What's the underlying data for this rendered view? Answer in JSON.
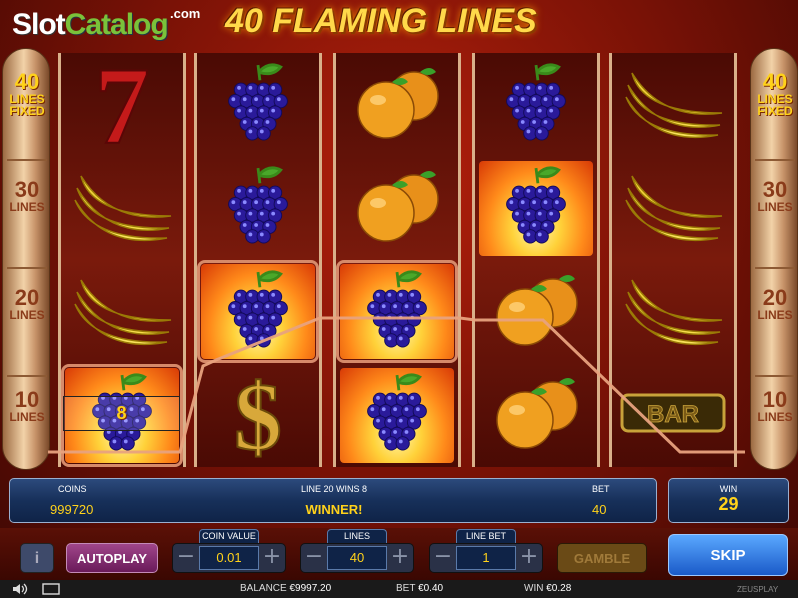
{
  "brand": {
    "slot": "Slot",
    "catalog": "Catalog",
    "com": ".com"
  },
  "game_title": "40 FLAMING LINES",
  "line_indicators": {
    "left": [
      {
        "num": "40",
        "lbl": "LINES",
        "lbl2": "FIXED",
        "active": true
      },
      {
        "num": "30",
        "lbl": "LINES",
        "active": false
      },
      {
        "num": "20",
        "lbl": "LINES",
        "active": false
      },
      {
        "num": "10",
        "lbl": "LINES",
        "active": false
      }
    ],
    "right": [
      {
        "num": "40",
        "lbl": "LINES",
        "lbl2": "FIXED",
        "active": true
      },
      {
        "num": "30",
        "lbl": "LINES",
        "active": false
      },
      {
        "num": "20",
        "lbl": "LINES",
        "active": false
      },
      {
        "num": "10",
        "lbl": "LINES",
        "active": false
      }
    ]
  },
  "reels": [
    [
      "seven",
      "banana",
      "banana",
      "grapes-flame-win"
    ],
    [
      "grapes",
      "grapes",
      "grapes-flame-win",
      "dollar"
    ],
    [
      "orange",
      "orange",
      "grapes-flame-win",
      "grapes-flame"
    ],
    [
      "grapes",
      "grapes-flame",
      "orange",
      "orange"
    ],
    [
      "banana",
      "banana",
      "banana",
      "bar"
    ]
  ],
  "symbol_text": {
    "bar": "BAR",
    "dollar": "$",
    "seven": "7"
  },
  "win_amount_on_reel": "8",
  "info": {
    "coins_label": "COINS",
    "coins_value": "999720",
    "line_text": "LINE 20 WINS 8",
    "status": "WINNER!",
    "bet_label": "BET",
    "bet_value": "40"
  },
  "win": {
    "label": "WIN",
    "value": "29"
  },
  "controls": {
    "info": "i",
    "autoplay": "AUTOPLAY",
    "coin_value": {
      "label": "COIN VALUE",
      "value": "0.01"
    },
    "lines": {
      "label": "LINES",
      "value": "40"
    },
    "line_bet": {
      "label": "LINE BET",
      "value": "1"
    },
    "gamble": "GAMBLE",
    "skip": "SKIP",
    "minus": "−",
    "plus": "+"
  },
  "status": {
    "balance_label": "BALANCE",
    "balance": "€9997.20",
    "bet_label": "BET",
    "bet": "€0.40",
    "win_label": "WIN",
    "win": "€0.28",
    "provider": "ZEUSPLAY"
  },
  "colors": {
    "accent": "#ffd21a",
    "panel": "#17305a",
    "background": "#7a1206"
  }
}
